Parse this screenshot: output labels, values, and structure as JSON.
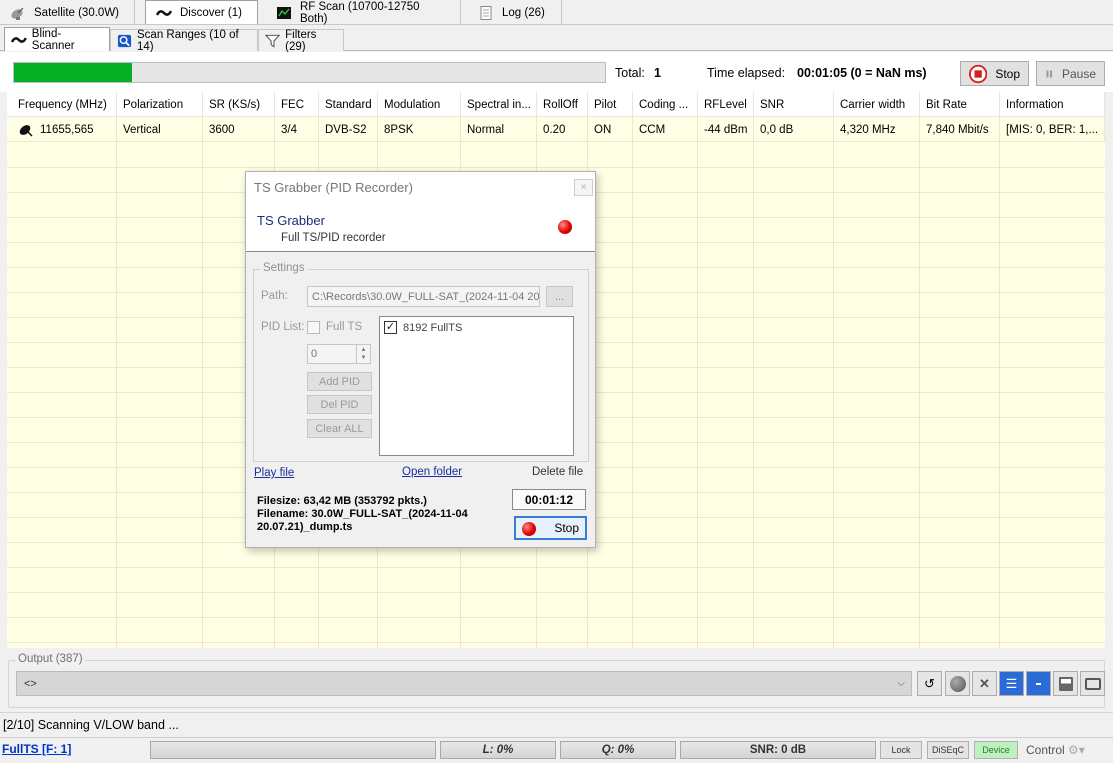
{
  "top_tabs": [
    {
      "label": "Satellite (30.0W)",
      "icon": "satellite-dish-icon"
    },
    {
      "label": "Discover (1)",
      "icon": "discover-icon"
    },
    {
      "label": "RF Scan (10700-12750 Both)",
      "icon": "rf-scan-icon"
    },
    {
      "label": "Log (26)",
      "icon": "log-icon"
    }
  ],
  "sub_tabs": [
    {
      "label": "Blind-Scanner",
      "icon": "blind-scanner-icon"
    },
    {
      "label": "Scan Ranges (10 of 14)",
      "icon": "scan-ranges-icon"
    },
    {
      "label": "Filters (29)",
      "icon": "filter-icon"
    }
  ],
  "progress": {
    "fraction": 0.2,
    "total_label": "Total:",
    "total_value": "1",
    "elapsed_label": "Time elapsed:",
    "elapsed_value": "00:01:05 (0 = NaN ms)",
    "stop_label": "Stop",
    "pause_label": "Pause",
    "accent_color": "#06b025"
  },
  "table": {
    "columns": [
      "Frequency (MHz)",
      "Polarization",
      "SR (KS/s)",
      "FEC",
      "Standard",
      "Modulation",
      "Spectral in...",
      "RollOff",
      "Pilot",
      "Coding ...",
      "RFLevel",
      "SNR",
      "Carrier width",
      "Bit Rate",
      "Information"
    ],
    "rows": [
      [
        "11655,565",
        "Vertical",
        "3600",
        "3/4",
        "DVB-S2",
        "8PSK",
        "Normal",
        "0.20",
        "ON",
        "CCM",
        "-44 dBm",
        "0,0 dB",
        "4,320 MHz",
        "7,840 Mbit/s",
        "[MIS: 0, BER: 1,..."
      ]
    ],
    "row_bg": "#ffffe6"
  },
  "dialog": {
    "window_title": "TS Grabber (PID Recorder)",
    "close_label": "×",
    "title": "TS Grabber",
    "subtitle": "Full TS/PID recorder",
    "settings_legend": "Settings",
    "path_label": "Path:",
    "path_value": "C:\\Records\\30.0W_FULL-SAT_(2024-11-04 20.",
    "browse_label": "...",
    "pidlist_label": "PID List:",
    "full_ts_label": "Full TS",
    "spin_value": "0",
    "add_pid": "Add PID",
    "del_pid": "Del PID",
    "clear_all": "Clear ALL",
    "pid_items": [
      {
        "label": "8192 FullTS",
        "checked": true
      }
    ],
    "play_file": "Play file",
    "open_folder": "Open folder",
    "delete_file": "Delete file",
    "filesize": "Filesize: 63,42 MB (353792 pkts.)",
    "filename": "Filename: 30.0W_FULL-SAT_(2024-11-04 20.07.21)_dump.ts",
    "timer": "00:01:12",
    "stop_label": "Stop",
    "record_color": "#e00000"
  },
  "output": {
    "legend": "Output (387)",
    "combo_value": "<>"
  },
  "status": {
    "text": "[2/10] Scanning V/LOW band ...",
    "link": "FullTS [F: 1]",
    "level": "L: 0%",
    "quality": "Q: 0%",
    "snr": "SNR: 0 dB",
    "lock": "Lock",
    "diseqc": "DiSEqC",
    "device": "Device",
    "control": "Control"
  }
}
